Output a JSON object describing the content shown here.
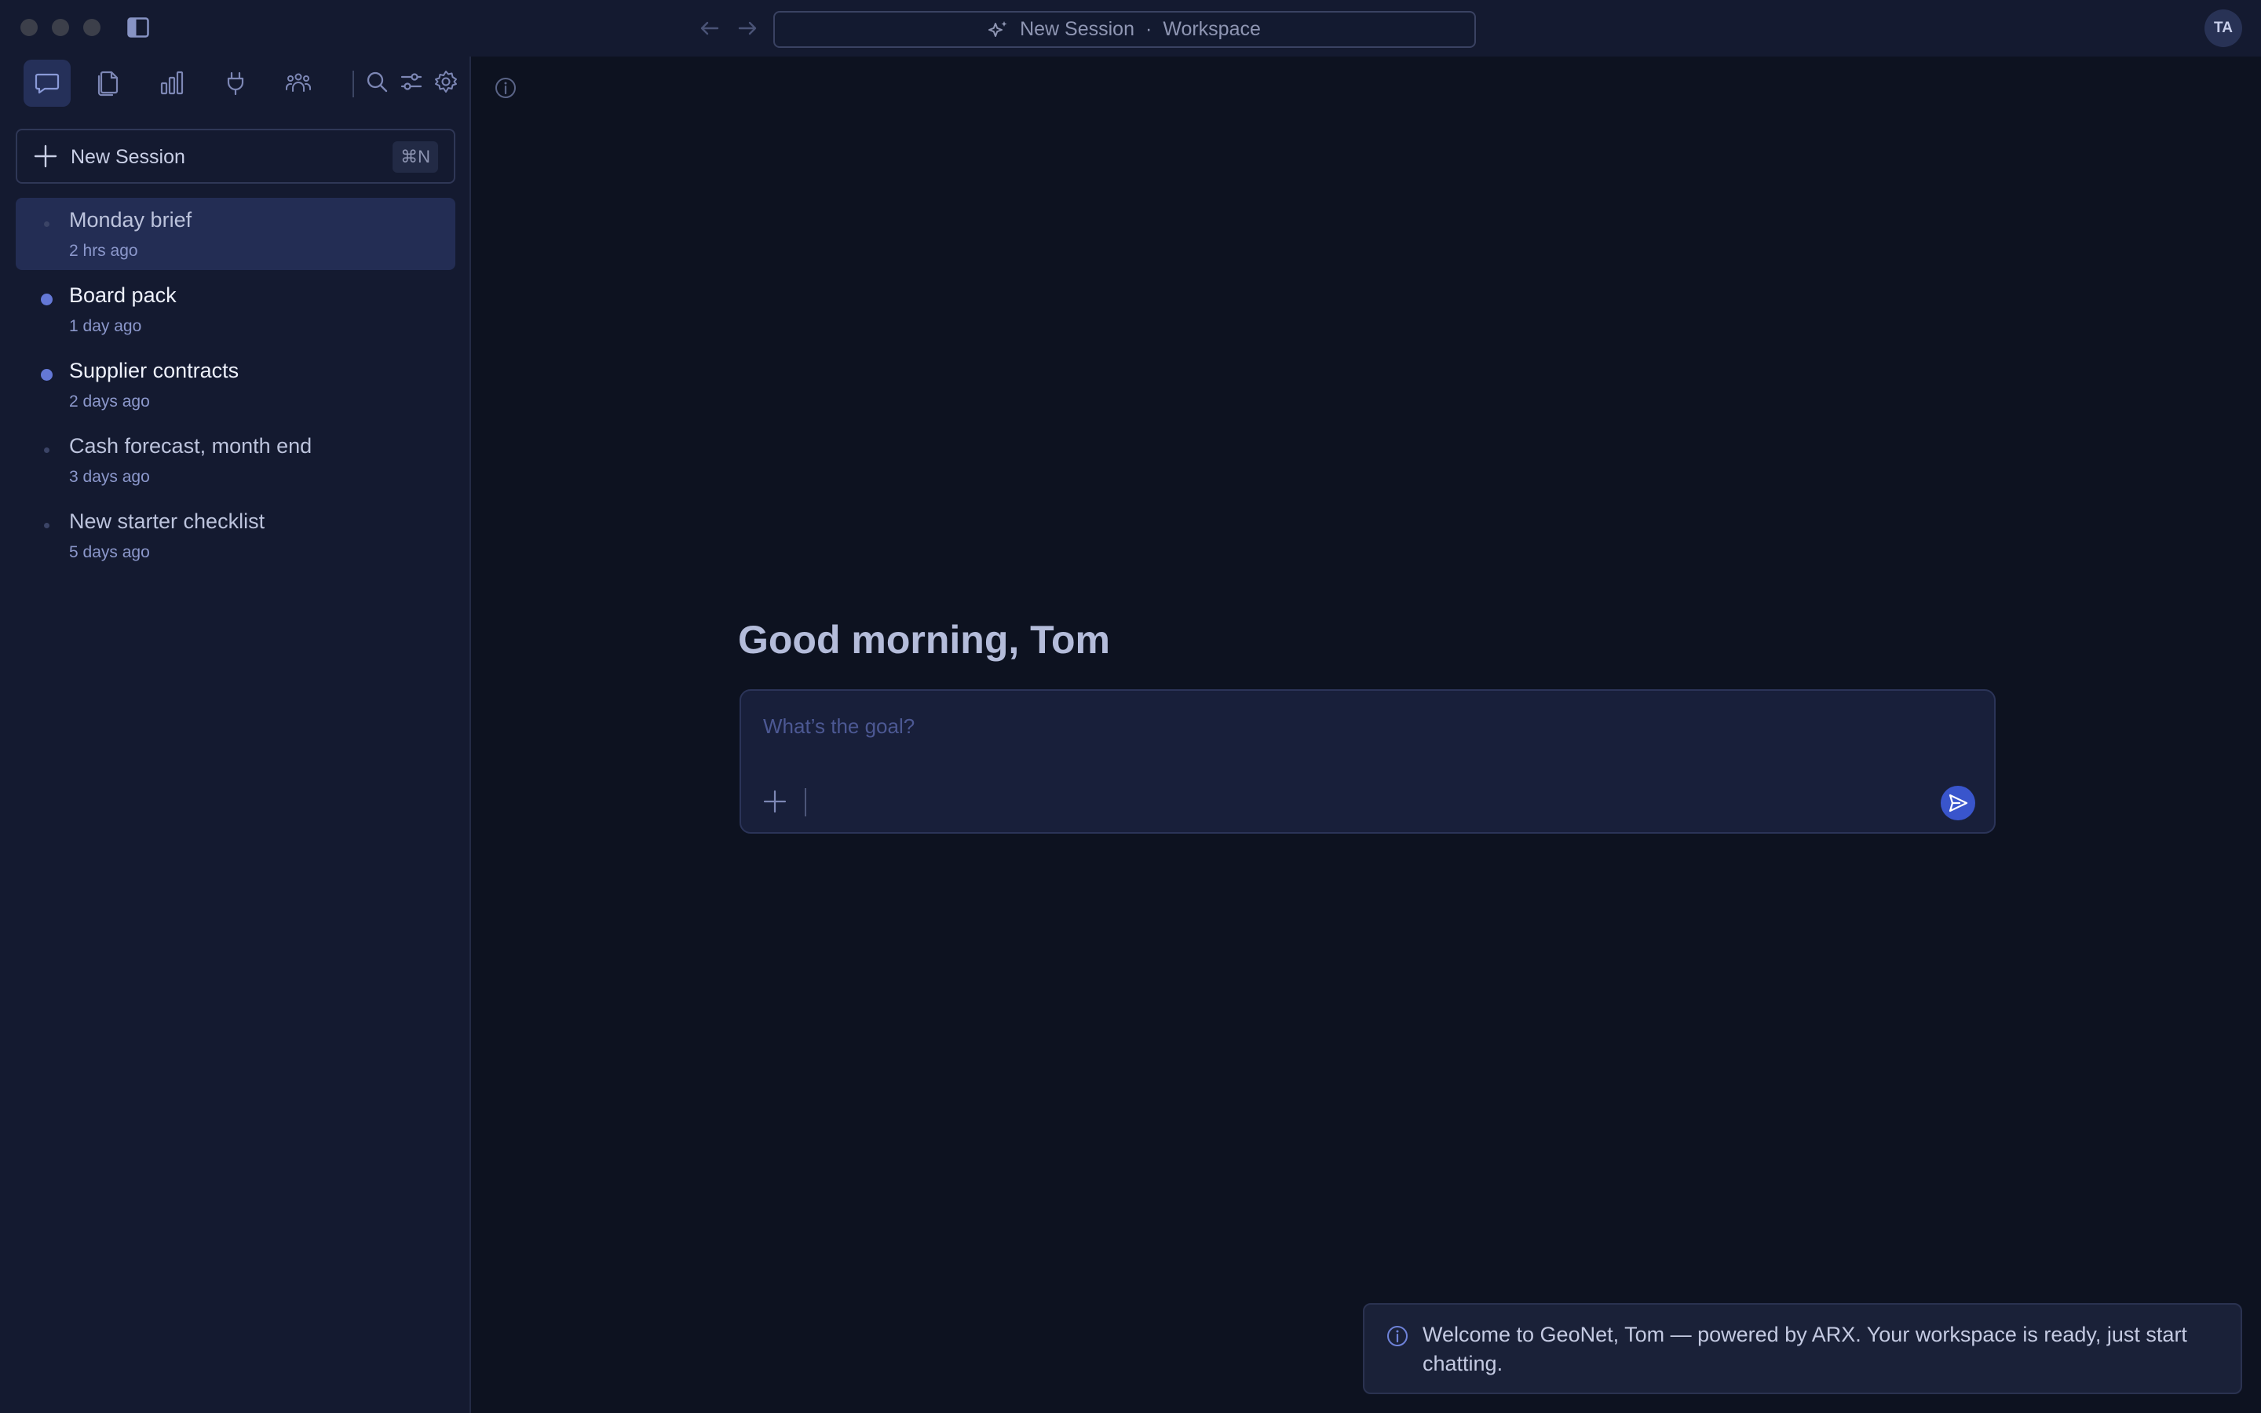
{
  "window": {
    "address": {
      "title": "New Session",
      "separator": "·",
      "context": "Workspace"
    },
    "avatar_initials": "TA"
  },
  "sidebar": {
    "icons": [
      "chat-icon",
      "documents-icon",
      "bar-chart-icon",
      "plug-icon",
      "team-icon",
      "search-icon",
      "sliders-icon",
      "gear-icon"
    ],
    "new_session": {
      "label": "New Session",
      "shortcut": "⌘N"
    },
    "sessions": [
      {
        "title": "Monday brief",
        "time": "2 hrs ago",
        "selected": true,
        "unread": false
      },
      {
        "title": "Board pack",
        "time": "1 day ago",
        "selected": false,
        "unread": true
      },
      {
        "title": "Supplier contracts",
        "time": "2 days ago",
        "selected": false,
        "unread": true
      },
      {
        "title": "Cash forecast, month end",
        "time": "3 days ago",
        "selected": false,
        "unread": false
      },
      {
        "title": "New starter checklist",
        "time": "5 days ago",
        "selected": false,
        "unread": false
      }
    ]
  },
  "main": {
    "greeting": "Good morning, Tom",
    "composer": {
      "placeholder": "What’s the goal?"
    },
    "toast": {
      "message": "Welcome to GeoNet, Tom — powered by ARX. Your workspace is ready, just start chatting."
    }
  },
  "colors": {
    "accent": "#3955cc",
    "unread_dot": "#6478d6",
    "selected_row": "#232d54",
    "background": "#0d1220",
    "sidebar": "#141a30"
  }
}
